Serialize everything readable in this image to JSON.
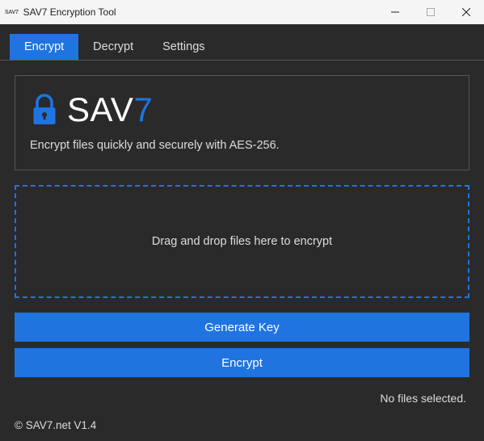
{
  "window": {
    "app_icon_text": "SAV7",
    "title": "SAV7 Encryption Tool"
  },
  "tabs": [
    {
      "label": "Encrypt",
      "active": true
    },
    {
      "label": "Decrypt",
      "active": false
    },
    {
      "label": "Settings",
      "active": false
    }
  ],
  "hero": {
    "brand_prefix": "SAV",
    "brand_accent": "7",
    "tagline": "Encrypt files quickly and securely with AES-256."
  },
  "dropzone": {
    "text": "Drag and drop files here to encrypt"
  },
  "buttons": {
    "generate_key": "Generate Key",
    "encrypt": "Encrypt"
  },
  "status": "No files selected.",
  "footer": "© SAV7.net V1.4",
  "icons": {
    "lock": "lock-icon",
    "minimize": "minimize-icon",
    "maximize": "maximize-icon",
    "close": "close-icon"
  },
  "colors": {
    "accent": "#1f74e0",
    "bg": "#2a2a2a",
    "titlebar": "#f5f5f5"
  }
}
